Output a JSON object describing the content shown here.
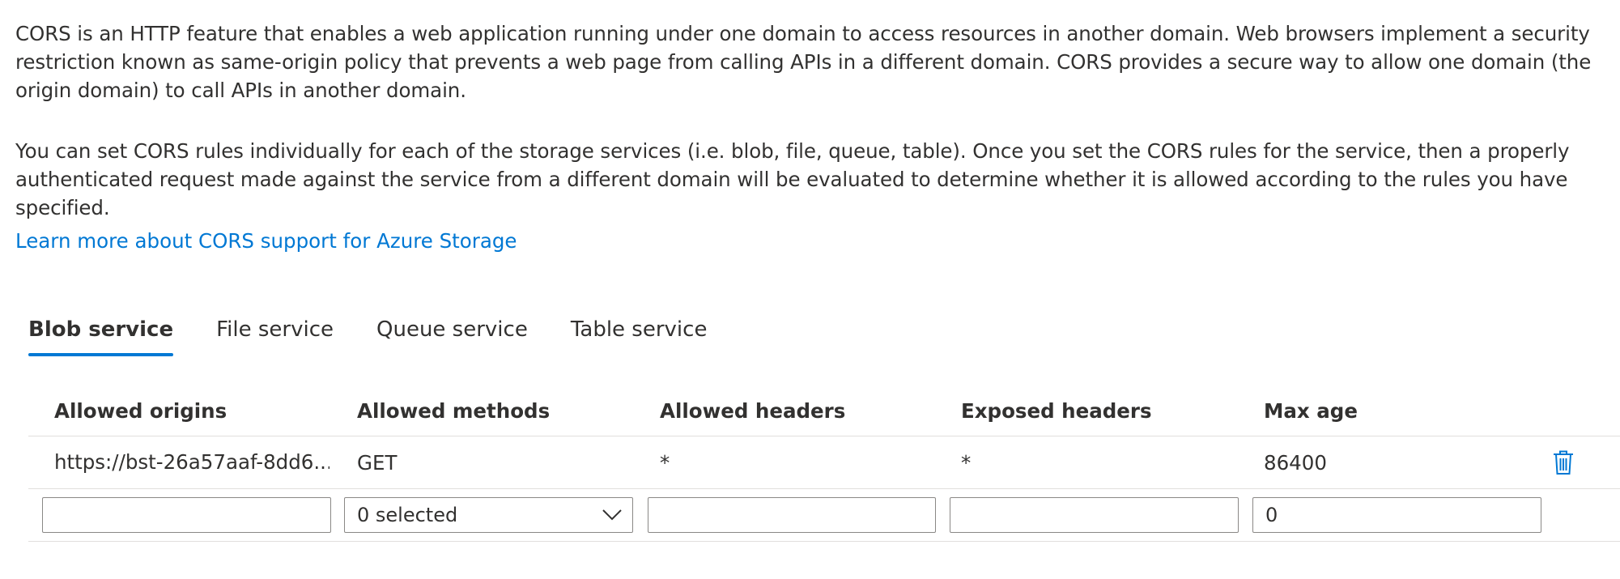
{
  "intro": {
    "paragraph1": "CORS is an HTTP feature that enables a web application running under one domain to access resources in another domain. Web browsers implement a security restriction known as same-origin policy that prevents a web page from calling APIs in a different domain. CORS provides a secure way to allow one domain (the origin domain) to call APIs in another domain.",
    "paragraph2": "You can set CORS rules individually for each of the storage services (i.e. blob, file, queue, table). Once you set the CORS rules for the service, then a properly authenticated request made against the service from a different domain will be evaluated to determine whether it is allowed according to the rules you have specified.",
    "learn_more_link": "Learn more about CORS support for Azure Storage"
  },
  "tabs": [
    {
      "label": "Blob service",
      "active": true
    },
    {
      "label": "File service",
      "active": false
    },
    {
      "label": "Queue service",
      "active": false
    },
    {
      "label": "Table service",
      "active": false
    }
  ],
  "table": {
    "columns": [
      "Allowed origins",
      "Allowed methods",
      "Allowed headers",
      "Exposed headers",
      "Max age"
    ],
    "rows": [
      {
        "allowed_origins": "https://bst-26a57aaf-8dd6...",
        "allowed_methods": "GET",
        "allowed_headers": "*",
        "exposed_headers": "*",
        "max_age": "86400",
        "delete_icon": "trash-icon"
      }
    ],
    "new_row": {
      "allowed_origins": "",
      "allowed_methods_selected": "0 selected",
      "allowed_headers": "",
      "exposed_headers": "",
      "max_age": "0",
      "dropdown_icon": "chevron-down-icon"
    }
  },
  "colors": {
    "accent": "#0078d4",
    "text": "#323130",
    "border": "#8a8886",
    "divider": "#e1dfdd"
  }
}
